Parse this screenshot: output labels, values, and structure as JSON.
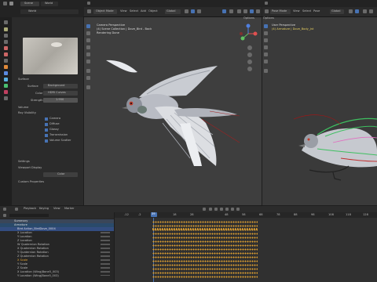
{
  "properties": {
    "tabs": [
      "Scene",
      "World"
    ],
    "world_name": "World",
    "preview_label": "Preview",
    "surface_section": "Surface",
    "surface_label": "Surface",
    "surface_value": "Background",
    "color_label": "Color",
    "color_value": "HDRI Curves",
    "strength_label": "Strength",
    "strength_value": "1.950",
    "volume_section": "Volume",
    "ray_visibility_section": "Ray Visibility",
    "rays": [
      "Camera",
      "Diffuse",
      "Glossy",
      "Transmission",
      "Volume Scatter"
    ],
    "settings_section": "Settings",
    "viewport_display_section": "Viewport Display",
    "viewport_display_value": "Color",
    "custom_props_section": "Custom Properties"
  },
  "viewport_left": {
    "mode": "Object Mode",
    "menus": [
      "View",
      "Select",
      "Add",
      "Object"
    ],
    "shading": "Global",
    "info_line1": "Camera Perspective",
    "info_line2": "(4) Scene Collection | Dove_Bird - Back",
    "info_line3": "Rendering Done",
    "options_label": "Options"
  },
  "viewport_right": {
    "mode": "Pose Mode",
    "menus": [
      "View",
      "Select",
      "Pose"
    ],
    "shading": "Global",
    "info_line1": "User Perspective",
    "info_line2": "(4) Armature | Dove_Body_Jnt",
    "options_label": "Options"
  },
  "timeline": {
    "menus": [
      "Playback",
      "Keying",
      "View",
      "Marker"
    ],
    "current_frame": "39",
    "ruler": [
      "-12",
      "-2",
      "8",
      "18",
      "28",
      "38",
      "48",
      "58",
      "68",
      "78",
      "88",
      "98",
      "108",
      "118",
      "128",
      "138"
    ],
    "channels": [
      "Summary",
      "Armature",
      "Bird Action_BirdDove_0004",
      "X Location",
      "Y Location",
      "Z Location",
      "W Quaternion Rotation",
      "X Quaternion Rotation",
      "Y Quaternion Rotation",
      "Z Quaternion Rotation",
      "X Scale",
      "Y Scale",
      "Z Scale",
      "X Location (Wing|Bone5_003)",
      "Y Location (Wing|Bone5_003)"
    ]
  },
  "colors": {
    "accent_blue": "#4772b3",
    "keyframe_orange": "#e0a030",
    "active_row": "#334d80",
    "selected_row": "#2a4a6a"
  }
}
